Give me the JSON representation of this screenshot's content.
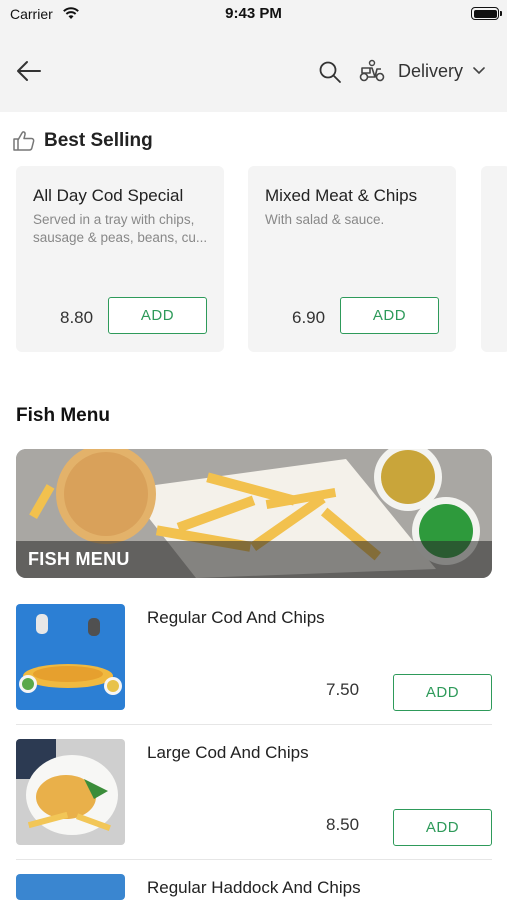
{
  "status_bar": {
    "carrier": "Carrier",
    "time": "9:43 PM"
  },
  "header": {
    "order_mode": "Delivery"
  },
  "best_selling": {
    "title": "Best Selling",
    "items": [
      {
        "name": "All Day Cod Special",
        "description": "Served in a tray with chips, sausage & peas, beans, cu...",
        "price": "8.80",
        "add_label": "ADD"
      },
      {
        "name": "Mixed Meat & Chips",
        "description": "With salad & sauce.",
        "price": "6.90",
        "add_label": "ADD"
      }
    ]
  },
  "fish_menu": {
    "title": "Fish Menu",
    "banner_label": "FISH MENU",
    "items": [
      {
        "name": "Regular Cod And Chips",
        "price": "7.50",
        "add_label": "ADD"
      },
      {
        "name": "Large Cod And Chips",
        "price": "8.50",
        "add_label": "ADD"
      },
      {
        "name": "Regular Haddock And Chips"
      }
    ]
  },
  "colors": {
    "accent": "#2e9a5a",
    "header_bg": "#f3f3f3",
    "card_bg": "#f4f4f4"
  },
  "icons": [
    "wifi-icon",
    "battery-icon",
    "back-arrow-icon",
    "search-icon",
    "scooter-icon",
    "chevron-down-icon",
    "thumbs-up-icon"
  ]
}
